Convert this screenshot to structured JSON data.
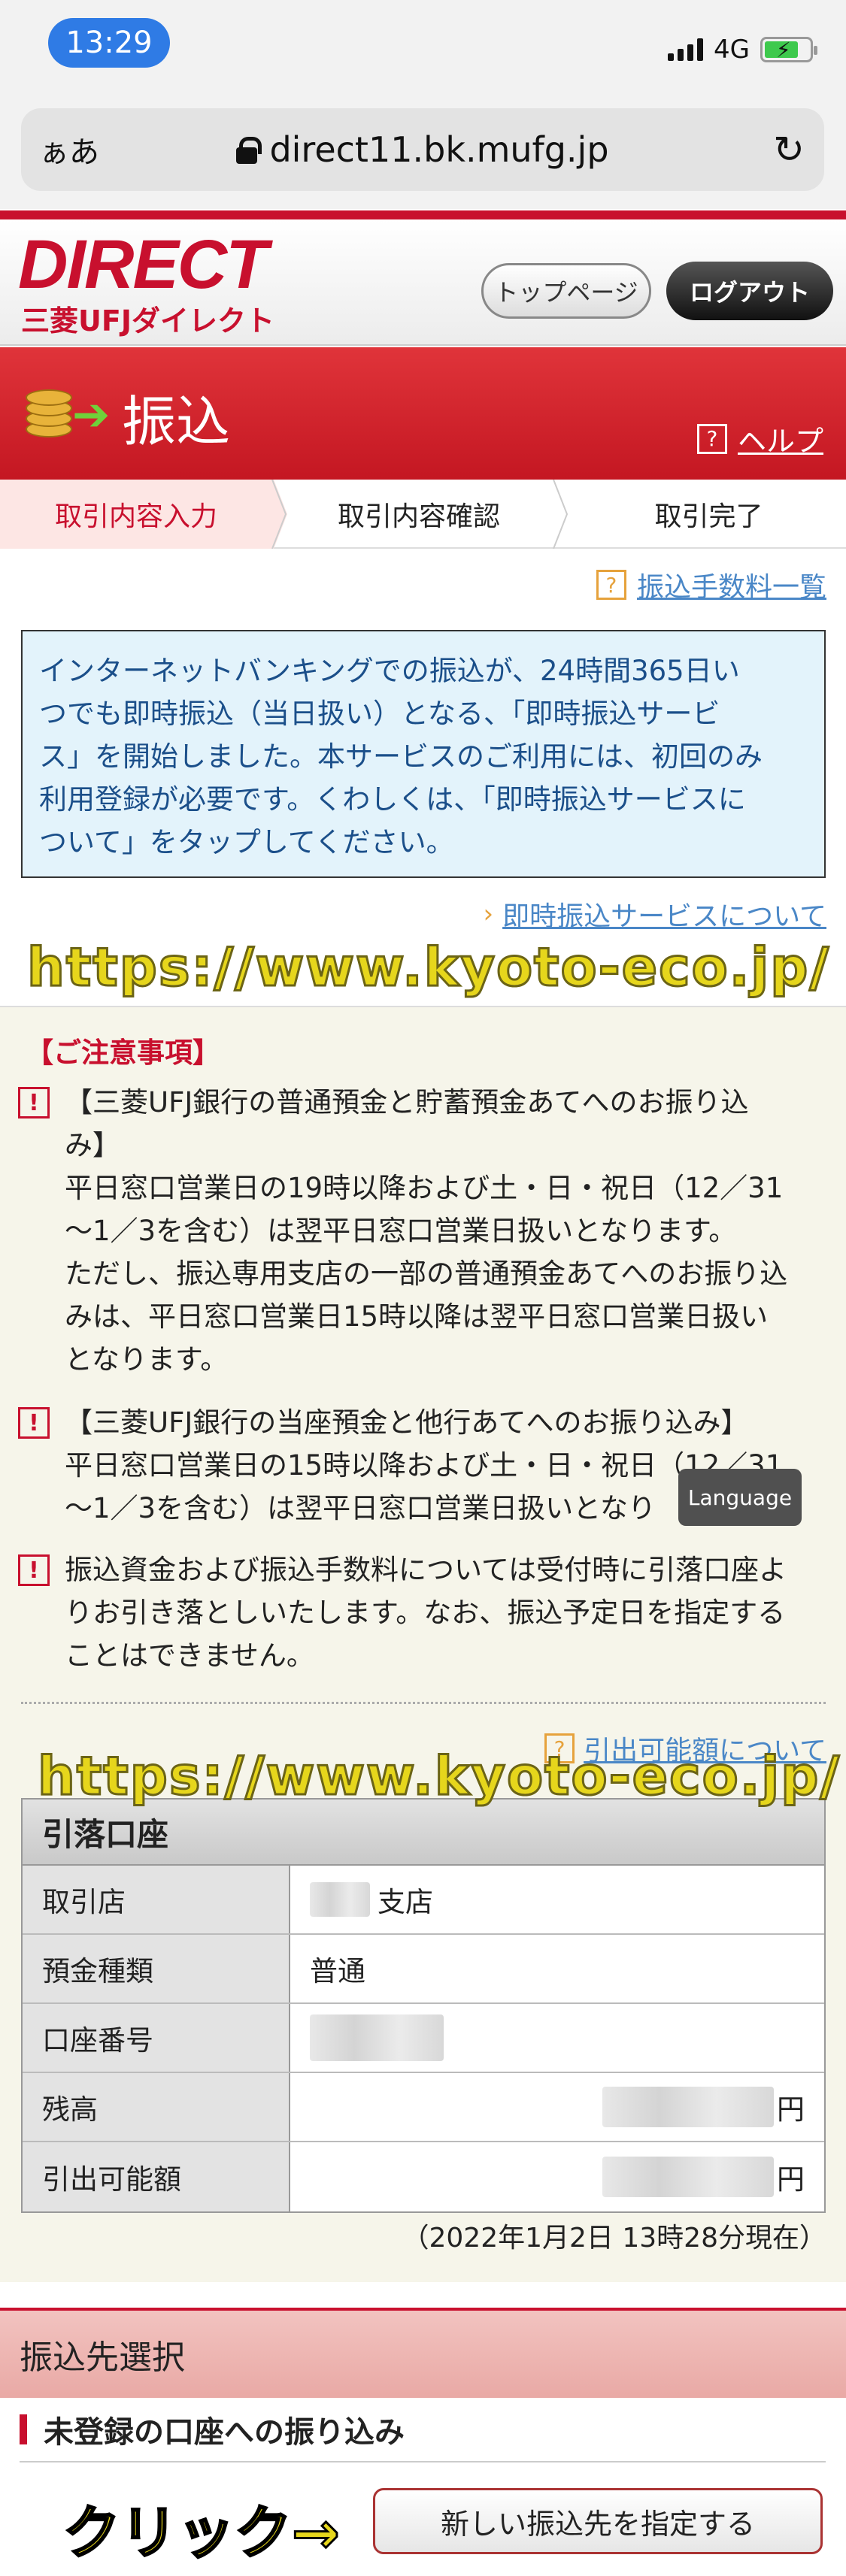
{
  "status_bar": {
    "time": "13:29",
    "network": "4G"
  },
  "browser": {
    "aa": "ぁあ",
    "url": "direct11.bk.mufg.jp"
  },
  "header": {
    "logo_main": "DIRECT",
    "logo_sub": "三菱UFJダイレクト",
    "top_page_label": "トップページ",
    "logout_label": "ログアウト"
  },
  "title_band": {
    "title": "振込",
    "help_label": "ヘルプ"
  },
  "steps": [
    "取引内容入力",
    "取引内容確認",
    "取引完了"
  ],
  "fee_link": "振込手数料一覧",
  "notice": [
    "インターネットバンキングでの振込が、24時間365日い",
    "つでも即時振込（当日扱い）となる、「即時振込サービ",
    "ス」を開始しました。本サービスのご利用には、初回のみ",
    "利用登録が必要です。くわしくは、「即時振込サービスに",
    "ついて」をタップしてください。"
  ],
  "instant_link": "即時振込サービスについて",
  "watermark": "https://www.kyoto-eco.jp/",
  "cautions": {
    "title": "【ご注意事項】",
    "items": [
      {
        "lines": [
          "【三菱UFJ銀行の普通預金と貯蓄預金あてへのお振り込",
          "み】",
          "平日窓口営業日の19時以降および土・日・祝日（12／31",
          "～1／3を含む）は翌平日窓口営業日扱いとなります。",
          "ただし、振込専用支店の一部の普通預金あてへのお振り込",
          "みは、平日窓口営業日15時以降は翌平日窓口営業日扱い",
          "となります。"
        ]
      },
      {
        "lines": [
          "【三菱UFJ銀行の当座預金と他行あてへのお振り込み】",
          "平日窓口営業日の15時以降および土・日・祝日（12／31",
          "～1／3を含む）は翌平日窓口営業日扱いとなり"
        ]
      },
      {
        "lines": [
          "振込資金および振込手数料については受付時に引落口座よ",
          "りお引き落としいたします。なお、振込予定日を指定する",
          "ことはできません。"
        ]
      }
    ]
  },
  "language_badge": "Language",
  "withdraw_link": "引出可能額について",
  "account": {
    "heading": "引落口座",
    "rows": [
      {
        "label": "取引店",
        "value": "支店"
      },
      {
        "label": "預金種類",
        "value": "普通"
      },
      {
        "label": "口座番号",
        "value": ""
      },
      {
        "label": "残高",
        "value": "円"
      },
      {
        "label": "引出可能額",
        "value": "円"
      }
    ],
    "as_of": "（2022年1月2日 13時28分現在）"
  },
  "destination": {
    "heading": "振込先選択",
    "unregistered_title": "未登録の口座への振り込み",
    "click_label": "クリック→",
    "new_dest_button": "新しい振込先を指定する"
  },
  "colors": {
    "brand_red": "#c8102e",
    "link_blue": "#4a87c7",
    "notice_bg": "#e3f3fb",
    "caution_bg": "#f6f5ea"
  }
}
